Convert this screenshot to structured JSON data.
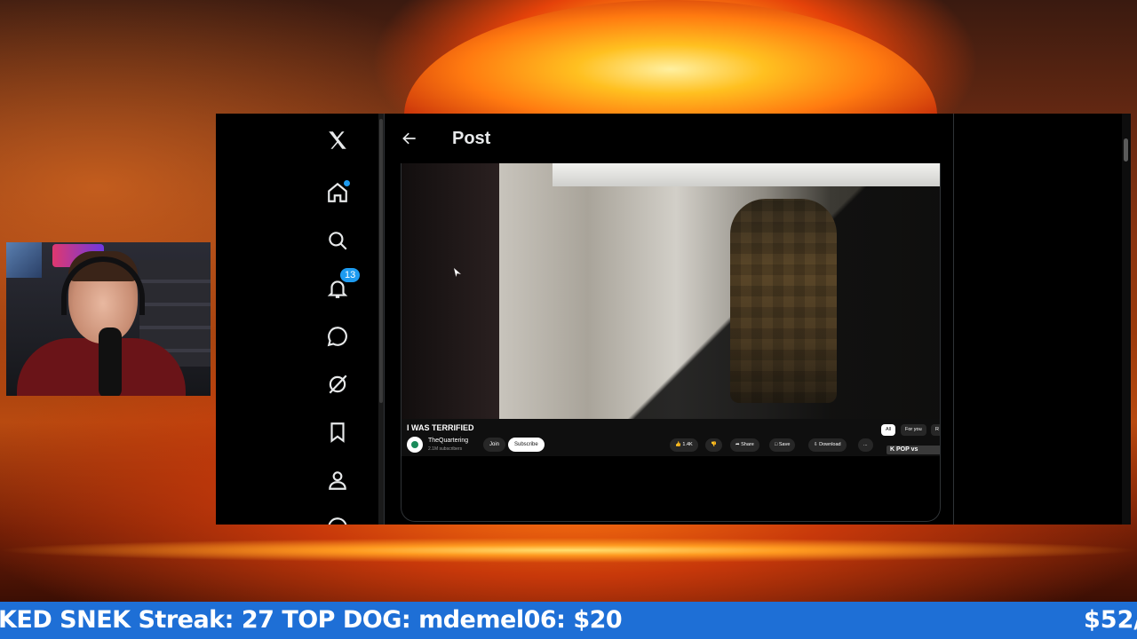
{
  "x_app": {
    "header": {
      "title": "Post"
    },
    "notifications_count": "13",
    "nav_items": [
      "home",
      "explore",
      "notifications",
      "messages",
      "grok",
      "bookmarks",
      "profile",
      "more"
    ]
  },
  "youtube_embed": {
    "video_title": "I WAS TERRIFIED",
    "channel_name": "TheQuartering",
    "subscribers": "2.1M subscribers",
    "join_label": "Join",
    "subscribe_label": "Subscribe",
    "like_count": "1.4K",
    "share_label": "Share",
    "save_label": "Save",
    "download_label": "Download",
    "more_label": "...",
    "chips": [
      "All",
      "For you",
      "R"
    ],
    "related_snippet": "K POP vs"
  },
  "ticker": {
    "text": "KED SNEK Streak: 27 TOP DOG: mdemel06: $20",
    "right_text": "$52/"
  }
}
